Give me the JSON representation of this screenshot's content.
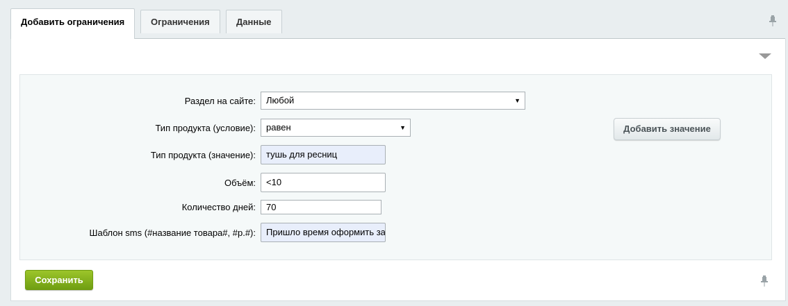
{
  "tabs": [
    {
      "label": "Добавить ограничения",
      "active": true
    },
    {
      "label": "Ограничения",
      "active": false
    },
    {
      "label": "Данные",
      "active": false
    }
  ],
  "form": {
    "section": {
      "label": "Раздел на сайте:",
      "value": "Любой"
    },
    "product_type_condition": {
      "label": "Тип продукта (условие):",
      "value": "равен"
    },
    "product_type_value": {
      "label": "Тип продукта (значение):",
      "value": "тушь для ресниц"
    },
    "volume": {
      "label": "Объём:",
      "value": "<10"
    },
    "days": {
      "label": "Количество дней:",
      "value": "70"
    },
    "sms_template": {
      "label": "Шаблон sms (#название товара#, #р.#):",
      "value": "Пришло время оформить за"
    }
  },
  "buttons": {
    "add_value": "Добавить значение",
    "save": "Сохранить"
  },
  "icons": {
    "pin": "pin-icon",
    "collapse": "collapse-arrow-icon",
    "select_arrow": "caret-down-icon"
  },
  "colors": {
    "save_button": "#84b41a",
    "filled_input": "#e8eefb",
    "page_background": "#e9eef0"
  }
}
